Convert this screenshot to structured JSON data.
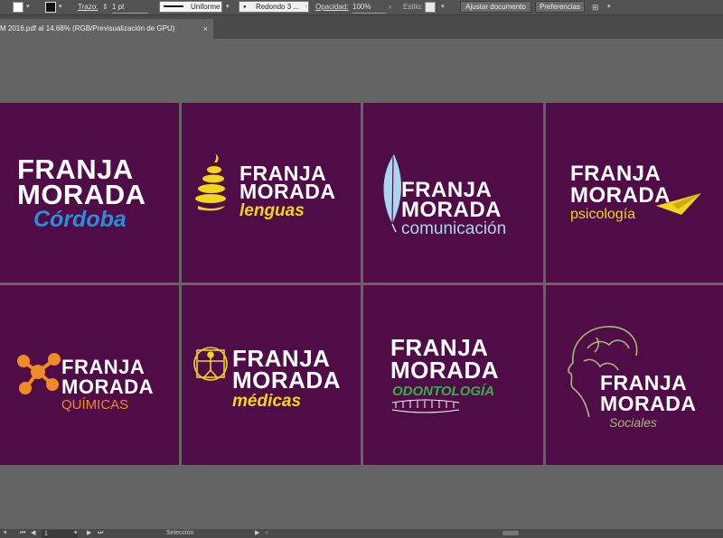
{
  "control_bar": {
    "stroke_label": "Trazo:",
    "stroke_weight": "1 pt",
    "profile": "Uniforme",
    "brush": "Redondo 3 ...",
    "opacity_label": "Opacidad:",
    "opacity_value": "100%",
    "style_label": "Estilo:",
    "doc_setup_button": "Ajustar documento",
    "preferences_button": "Preferencias",
    "fill_color": "#ffffff",
    "stroke_color": "#000000"
  },
  "document_tab": {
    "title": "M 2016.pdf al 14.68% (RGB/Previsualización de GPU)",
    "close": "×"
  },
  "canvas": {
    "artboard_color": "#4f0c46",
    "logos": [
      {
        "line1": "FRANJA",
        "line2": "MORADA",
        "sub": "Córdoba",
        "sub_color": "#2a8fd8"
      },
      {
        "line1": "FRANJA",
        "line2": "MORADA",
        "sub": "lenguas",
        "sub_color": "#f2d51c"
      },
      {
        "line1": "FRANJA",
        "line2": "MORADA",
        "sub": "comunicación",
        "sub_color": "#a9d6f0"
      },
      {
        "line1": "FRANJA",
        "line2": "MORADA",
        "sub": "psicología",
        "sub_color": "#f2d51c"
      },
      {
        "line1": "FRANJA",
        "line2": "MORADA",
        "sub": "QUÍMICAS",
        "sub_color": "#f08a24"
      },
      {
        "line1": "FRANJA",
        "line2": "MORADA",
        "sub": "médicas",
        "sub_color": "#f2d51c"
      },
      {
        "line1": "FRANJA",
        "line2": "MORADA",
        "sub": "ODONTOLOGÍA",
        "sub_color": "#33b24a"
      },
      {
        "line1": "FRANJA",
        "line2": "MORADA",
        "sub": "Sociales",
        "sub_color": "#a9b77a"
      }
    ]
  },
  "status_bar": {
    "page": "1",
    "tool": "Selección"
  }
}
